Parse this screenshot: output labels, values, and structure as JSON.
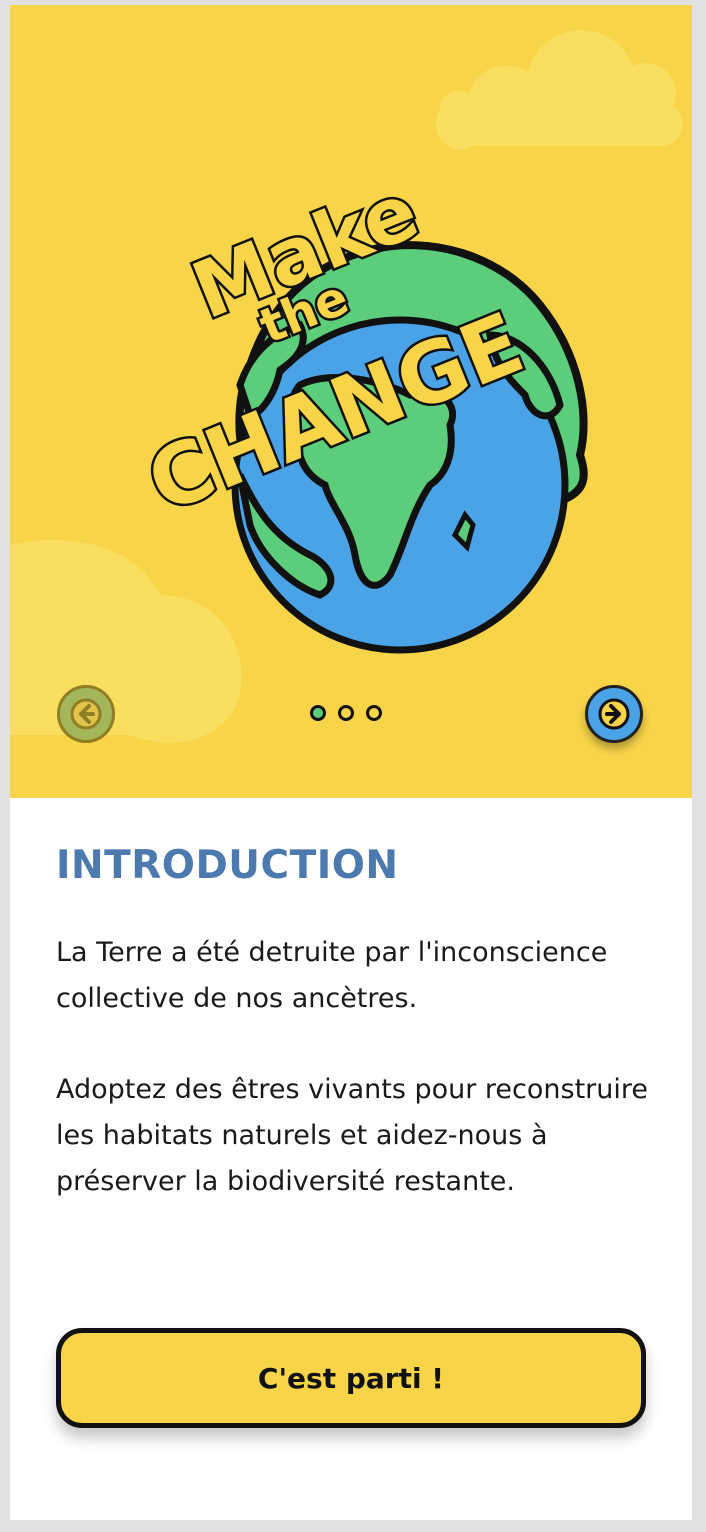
{
  "theme": {
    "hero_bg": "#f8d449",
    "title_color": "#4c79ae",
    "accent_green": "#5ccd7a",
    "accent_blue": "#4aa3e6"
  },
  "hero": {
    "logo_text": [
      "Make",
      "the",
      "CHANGE"
    ],
    "logo_icon": "earth-globe-icon",
    "prev_icon": "arrow-left-icon",
    "next_icon": "arrow-right-icon",
    "pager": {
      "total": 3,
      "active": 1
    }
  },
  "content": {
    "title": "INTRODUCTION",
    "paragraph1": "La Terre a été detruite par l'inconscience collective de nos ancètres.",
    "paragraph2": "Adoptez des êtres vivants pour reconstruire les habitats naturels et aidez-nous à préserver la biodiversité restante."
  },
  "cta": {
    "label": "C'est parti !"
  }
}
